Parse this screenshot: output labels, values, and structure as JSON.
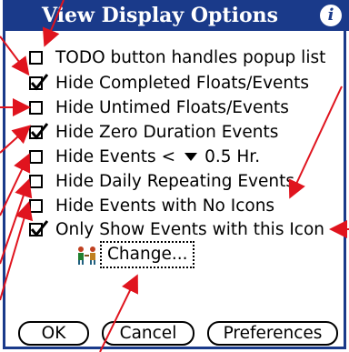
{
  "dialog": {
    "title": "View Display Options",
    "info_icon": "i"
  },
  "options": [
    {
      "label": "TODO button handles popup list",
      "checked": false
    },
    {
      "label": "Hide Completed Floats/Events",
      "checked": true
    },
    {
      "label": "Hide Untimed Floats/Events",
      "checked": false
    },
    {
      "label": "Hide Zero Duration Events",
      "checked": true
    },
    {
      "label_prefix": "Hide Events <",
      "select_value": "0.5 Hr.",
      "checked": false
    },
    {
      "label": "Hide Daily Repeating Events",
      "checked": false
    },
    {
      "label": "Hide Events with No Icons",
      "checked": false
    },
    {
      "label": "Only Show Events with this Icon",
      "checked": true
    }
  ],
  "icon_selector": {
    "icon": "people-icon",
    "change_label": "Change..."
  },
  "buttons": {
    "ok": "OK",
    "cancel": "Cancel",
    "preferences": "Preferences"
  },
  "colors": {
    "title_bar": "#1a3a8a",
    "annotation_arrows": "#e0141e"
  }
}
